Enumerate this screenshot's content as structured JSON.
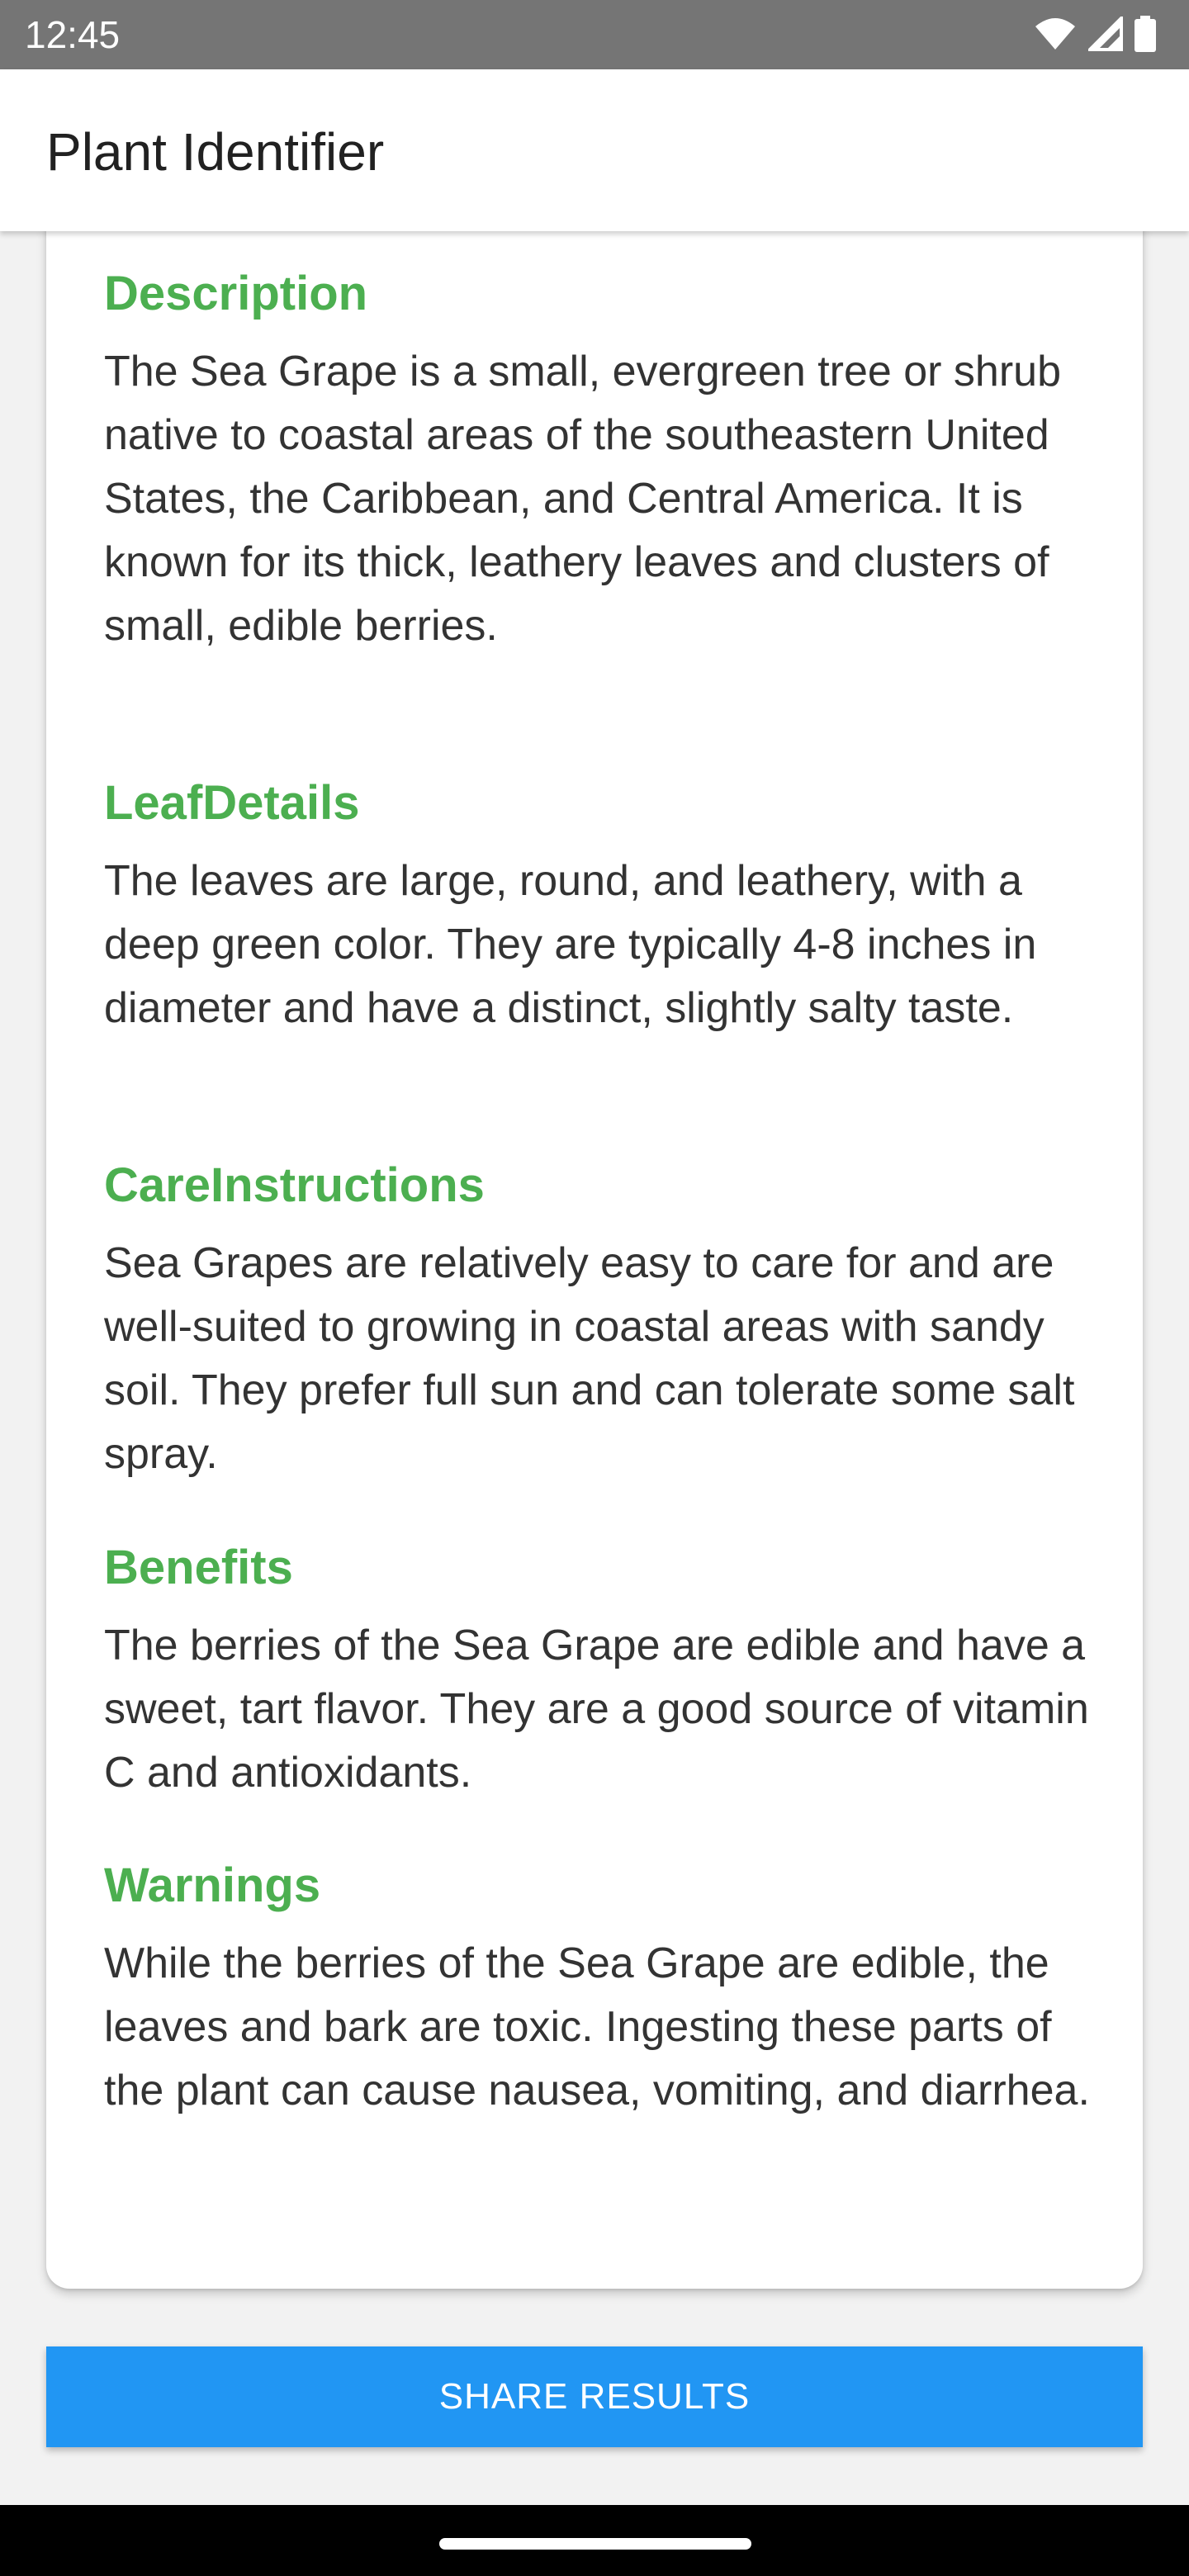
{
  "status_bar": {
    "time": "12:45",
    "icons": [
      "wifi-icon",
      "signal-icon",
      "battery-icon"
    ]
  },
  "app_bar": {
    "title": "Plant Identifier"
  },
  "sections": [
    {
      "heading": "Description",
      "body": "The Sea Grape is a small, evergreen tree or shrub native to coastal areas of the southeastern United States, the Caribbean, and Central America. It is known for its thick, leathery leaves and clusters of small, edible berries."
    },
    {
      "heading": "LeafDetails",
      "body": "The leaves are large, round, and leathery, with a deep green color. They are typically 4-8 inches in diameter and have a distinct, slightly salty taste."
    },
    {
      "heading": "CareInstructions",
      "body": "Sea Grapes are relatively easy to care for and are well-suited to growing in coastal areas with sandy soil. They prefer full sun and can tolerate some salt spray."
    },
    {
      "heading": "Benefits",
      "body": "The berries of the Sea Grape are edible and have a sweet, tart flavor. They are a good source of vitamin C and antioxidants."
    },
    {
      "heading": "Warnings",
      "body": "While the berries of the Sea Grape are edible, the leaves and bark are toxic. Ingesting these parts of the plant can cause nausea, vomiting, and diarrhea."
    }
  ],
  "share_button": {
    "label": "SHARE RESULTS"
  },
  "colors": {
    "heading": "#4caf50",
    "button": "#2196f3",
    "status_bar": "#757575"
  }
}
